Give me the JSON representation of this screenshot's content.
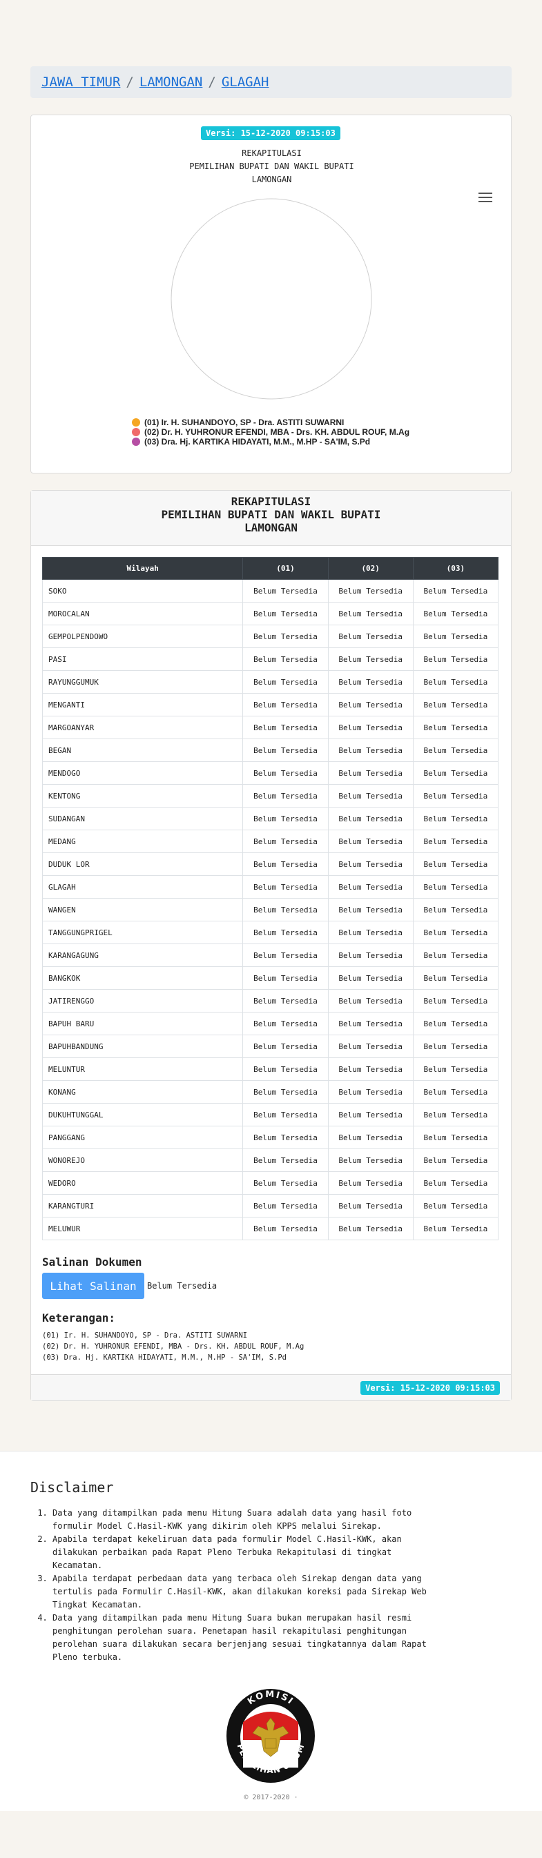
{
  "breadcrumb": {
    "items": [
      "JAWA TIMUR",
      "LAMONGAN",
      "GLAGAH"
    ],
    "separator": "/"
  },
  "version_badge": "Versi: 15-12-2020 09:15:03",
  "chart_title": {
    "line1": "REKAPITULASI",
    "line2": "PEMILIHAN BUPATI DAN WAKIL BUPATI",
    "line3": "LAMONGAN"
  },
  "chart_data": {
    "type": "pie",
    "legend_position": "bottom",
    "categories": [
      "(01) Ir. H. SUHANDOYO, SP - Dra. ASTITI SUWARNI",
      "(02) Dr. H. YUHRONUR EFENDI, MBA - Drs. KH. ABDUL ROUF, M.Ag",
      "(03) Dra. Hj. KARTIKA HIDAYATI, M.M., M.HP - SA'IM, S.Pd"
    ],
    "values": [
      null,
      null,
      null
    ],
    "colors": [
      "#f5a623",
      "#f06a6a",
      "#b64fa4"
    ]
  },
  "table": {
    "title": {
      "line1": "REKAPITULASI",
      "line2": "PEMILIHAN BUPATI DAN WAKIL BUPATI",
      "line3": "LAMONGAN"
    },
    "headers": [
      "Wilayah",
      "(01)",
      "(02)",
      "(03)"
    ],
    "cell_value": "Belum Tersedia",
    "rows": [
      "SOKO",
      "MOROCALAN",
      "GEMPOLPENDOWO",
      "PASI",
      "RAYUNGGUMUK",
      "MENGANTI",
      "MARGOANYAR",
      "BEGAN",
      "MENDOGO",
      "KENTONG",
      "SUDANGAN",
      "MEDANG",
      "DUDUK LOR",
      "GLAGAH",
      "WANGEN",
      "TANGGUNGPRIGEL",
      "KARANGAGUNG",
      "BANGKOK",
      "JATIRENGGO",
      "BAPUH BARU",
      "BAPUHBANDUNG",
      "MELUNTUR",
      "KONANG",
      "DUKUHTUNGGAL",
      "PANGGANG",
      "WONOREJO",
      "WEDORO",
      "KARANGTURI",
      "MELUWUR"
    ]
  },
  "salinan": {
    "title": "Salinan Dokumen",
    "button": "Lihat Salinan",
    "status": "Belum Tersedia"
  },
  "keterangan": {
    "title": "Keterangan:",
    "items": [
      "(01) Ir. H. SUHANDOYO, SP - Dra. ASTITI SUWARNI",
      "(02) Dr. H. YUHRONUR EFENDI, MBA - Drs. KH. ABDUL ROUF, M.Ag",
      "(03) Dra. Hj. KARTIKA HIDAYATI, M.M., M.HP - SA'IM, S.Pd"
    ]
  },
  "disclaimer": {
    "title": "Disclaimer",
    "items": [
      "Data yang ditampilkan pada menu Hitung Suara adalah data yang hasil foto formulir Model C.Hasil-KWK yang dikirim oleh KPPS melalui Sirekap.",
      "Apabila terdapat kekeliruan data pada formulir Model C.Hasil-KWK, akan dilakukan perbaikan pada Rapat Pleno Terbuka Rekapitulasi di tingkat Kecamatan.",
      "Apabila terdapat perbedaan data yang terbaca oleh Sirekap dengan data yang tertulis pada Formulir C.Hasil-KWK, akan dilakukan koreksi pada Sirekap Web Tingkat Kecamatan.",
      "Data yang ditampilkan pada menu Hitung Suara bukan merupakan hasil resmi penghitungan perolehan suara. Penetapan hasil rekapitulasi penghitungan perolehan suara dilakukan secara berjenjang sesuai tingkatannya dalam Rapat Pleno terbuka."
    ]
  },
  "logo": {
    "top_text": "KOMISI",
    "bottom_text": "PEMILIHAN UMUM"
  },
  "footer": {
    "copyright": "© 2017-2020 ·"
  }
}
